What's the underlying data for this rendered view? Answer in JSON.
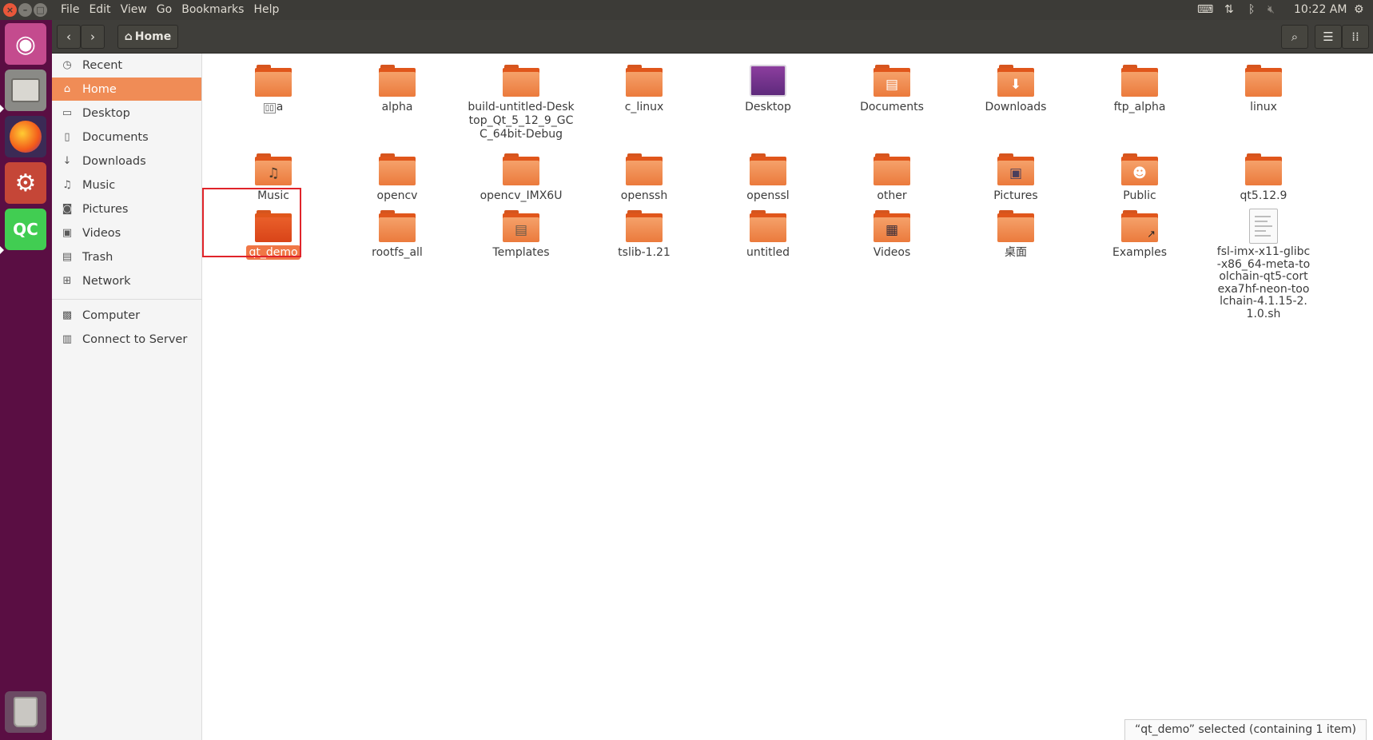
{
  "menubar": {
    "items": [
      "File",
      "Edit",
      "View",
      "Go",
      "Bookmarks",
      "Help"
    ],
    "time": "10:22 AM"
  },
  "launcher": {
    "apps": [
      "ubuntu-dash-icon",
      "files-icon",
      "firefox-icon",
      "system-settings-icon",
      "qt-creator-icon",
      "trash-icon"
    ],
    "qt_label": "QC"
  },
  "toolbar": {
    "breadcrumb": "Home"
  },
  "sidebar": {
    "items": [
      {
        "label": "Recent",
        "icon": "clock-icon"
      },
      {
        "label": "Home",
        "icon": "home-icon"
      },
      {
        "label": "Desktop",
        "icon": "folder-icon"
      },
      {
        "label": "Documents",
        "icon": "document-icon"
      },
      {
        "label": "Downloads",
        "icon": "download-icon"
      },
      {
        "label": "Music",
        "icon": "music-icon"
      },
      {
        "label": "Pictures",
        "icon": "camera-icon"
      },
      {
        "label": "Videos",
        "icon": "video-icon"
      },
      {
        "label": "Trash",
        "icon": "trash-icon"
      },
      {
        "label": "Network",
        "icon": "network-icon"
      },
      {
        "label": "Computer",
        "icon": "computer-icon"
      },
      {
        "label": "Connect to Server",
        "icon": "server-icon"
      }
    ],
    "active": "Home"
  },
  "files": [
    {
      "label": "a"
    },
    {
      "label": "alpha"
    },
    {
      "label": "build-untitled-Desktop_Qt_5_12_9_GCC_64bit-Debug"
    },
    {
      "label": "c_linux"
    },
    {
      "label": "Desktop"
    },
    {
      "label": "Documents"
    },
    {
      "label": "Downloads"
    },
    {
      "label": "ftp_alpha"
    },
    {
      "label": "linux"
    },
    {
      "label": "Music"
    },
    {
      "label": "opencv"
    },
    {
      "label": "opencv_IMX6U"
    },
    {
      "label": "openssh"
    },
    {
      "label": "openssl"
    },
    {
      "label": "other"
    },
    {
      "label": "Pictures"
    },
    {
      "label": "Public"
    },
    {
      "label": "qt5.12.9"
    },
    {
      "label": "qt_demo"
    },
    {
      "label": "rootfs_all"
    },
    {
      "label": "Templates"
    },
    {
      "label": "tslib-1.21"
    },
    {
      "label": "untitled"
    },
    {
      "label": "Videos"
    },
    {
      "label": "桌面"
    },
    {
      "label": "Examples"
    },
    {
      "label": "fsl-imx-x11-glibc-x86_64-meta-toolchain-qt5-cortexa7hf-neon-toolchain-4.1.15-2.1.0.sh"
    }
  ],
  "selected_file": "qt_demo",
  "status": "“qt_demo” selected  (containing 1 item)"
}
